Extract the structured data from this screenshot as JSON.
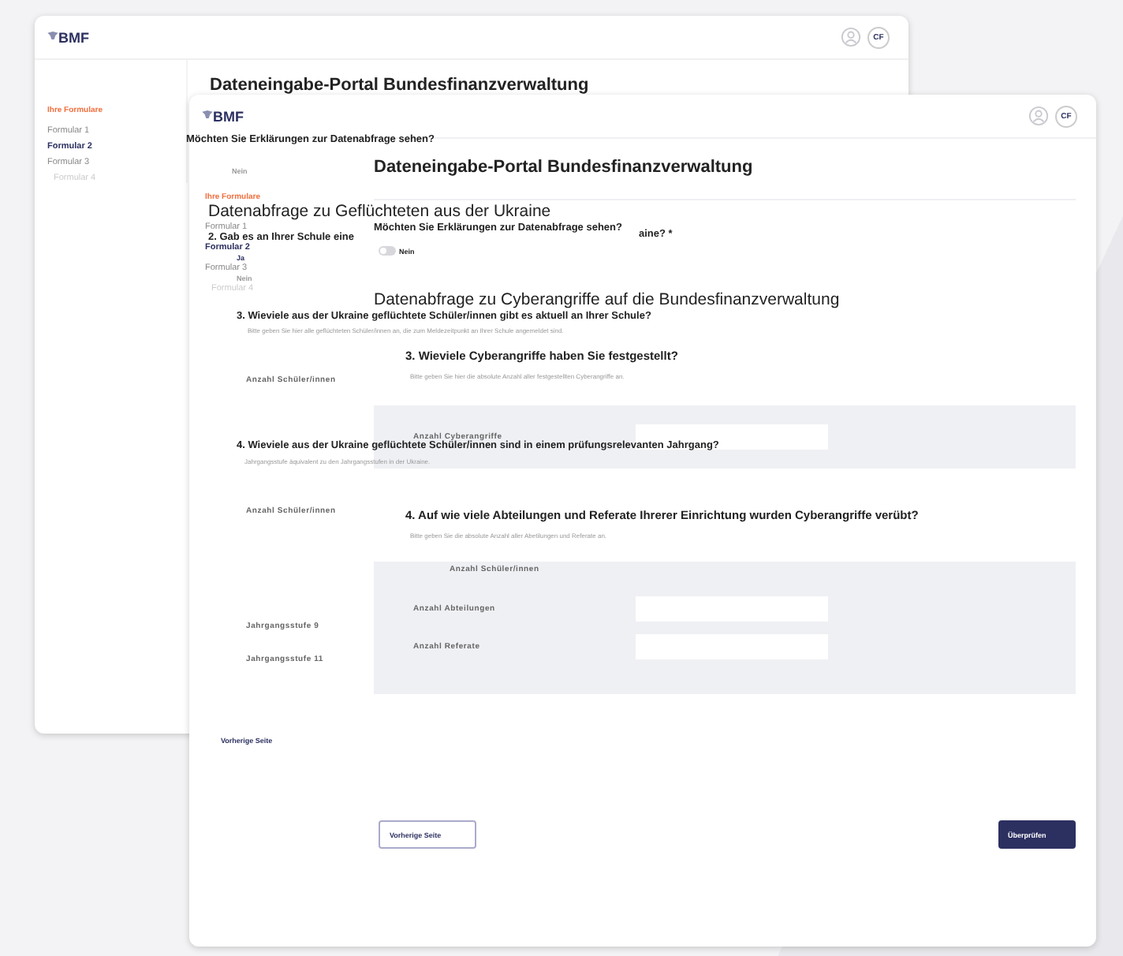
{
  "back_window": {
    "logo": "BMF",
    "user_initials": "CF",
    "title": "Dateneingabe-Portal Bundesfinanzverwaltung",
    "sidebar": {
      "heading": "Ihre Formulare",
      "items": [
        {
          "label": "Formular 1",
          "selected": false,
          "disabled": false
        },
        {
          "label": "Formular 2",
          "selected": true,
          "disabled": false
        },
        {
          "label": "Formular 3",
          "selected": false,
          "disabled": false
        },
        {
          "label": "Formular 4",
          "selected": false,
          "disabled": true
        }
      ]
    }
  },
  "front_window": {
    "logo": "BMF",
    "user_initials": "CF",
    "title": "Dateneingabe-Portal Bundesfinanzverwaltung",
    "sidebar": {
      "heading": "Ihre Formulare",
      "items": [
        {
          "label": "Formular 1",
          "selected": false,
          "disabled": false
        },
        {
          "label": "Formular 2",
          "selected": true,
          "disabled": false
        },
        {
          "label": "Formular 3",
          "selected": false,
          "disabled": false
        },
        {
          "label": "Formular 4",
          "selected": false,
          "disabled": true
        }
      ]
    },
    "explanations": {
      "question": "Möchten Sie Erklärungen zur Datenabfrage sehen?",
      "toggle_label": "Nein",
      "on": false
    },
    "section_title": "Datenabfrage zu Cyberangriffe auf die Bundesfinanzverwaltung",
    "questions": [
      {
        "question": "3. Wieviele Cyberangriffe haben Sie festgestellt?",
        "hint": "Bitte geben Sie hier die absolute Anzahl aller festgestellten Cyberangriffe an.",
        "fields": [
          {
            "label": "Anzahl Cyberangriffe"
          }
        ]
      },
      {
        "question": "4. Auf wie viele Abteilungen und Referate Ihrerer Einrichtung wurden Cyberangriffe verübt?",
        "hint": "Bitte geben Sie die absolute Anzahl aller Abetilungen und Referate an.",
        "fields": [
          {
            "label": "Anzahl Abteilungen"
          },
          {
            "label": "Anzahl Referate"
          }
        ]
      }
    ],
    "buttons": [
      {
        "label": "Vorherige Seite",
        "kind": "secondary"
      },
      {
        "label": "Überprüfen",
        "kind": "primary"
      }
    ]
  },
  "overlay": {
    "items": [
      {
        "kind": "question",
        "text": "Möchten Sie Erklärungen zur Datenabfrage sehen?"
      },
      {
        "kind": "option",
        "text": "Nein",
        "selected": false
      },
      {
        "kind": "heading",
        "text": "Datenabfrage zu Geflüchteten aus der Ukraine"
      },
      {
        "kind": "question",
        "text": "2. Gab es an Ihrer Schule eine"
      },
      {
        "kind": "question",
        "text": "aine? *"
      },
      {
        "kind": "option",
        "text": "Ja",
        "selected": true
      },
      {
        "kind": "option",
        "text": "Nein",
        "selected": false
      },
      {
        "kind": "question",
        "text": "3. Wieviele aus der Ukraine geflüchtete Schüler/innen gibt es aktuell an Ihrer Schule?"
      },
      {
        "kind": "hint",
        "text": "Bitte geben Sie hier alle geflüchteten Schüler/innen an, die zum Meldezeitpunkt an Ihrer Schule angemeldet sind."
      },
      {
        "kind": "label",
        "text": "Anzahl Schüler/innen"
      },
      {
        "kind": "question",
        "text": "4. Wieviele aus der Ukraine geflüchtete Schüler/innen sind  in einem prüfungsrelevanten Jahrgang?"
      },
      {
        "kind": "hint",
        "text": "Jahrgangsstufe äquivalent zu den Jahrgangsstufen in der Ukraine."
      },
      {
        "kind": "label",
        "text": "Anzahl Schüler/innen"
      },
      {
        "kind": "label",
        "text": "Anzahl Schüler/innen"
      },
      {
        "kind": "label",
        "text": "Jahrgangsstufe 9"
      },
      {
        "kind": "label",
        "text": "Jahrgangsstufe 11"
      },
      {
        "kind": "link",
        "text": "Vorherige Seite"
      }
    ]
  }
}
